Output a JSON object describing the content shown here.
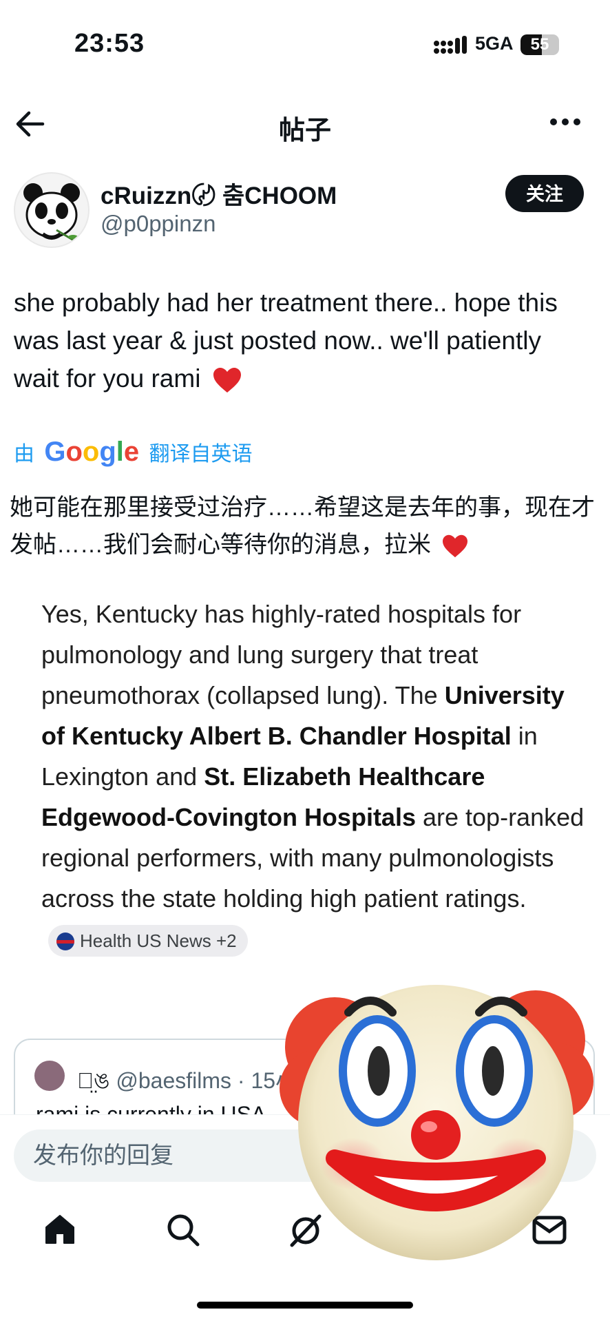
{
  "status_bar": {
    "time": "23:53",
    "network": "5GA",
    "battery": "55",
    "battery_level": 0.55
  },
  "header": {
    "title": "帖子"
  },
  "author": {
    "name": "cRuizzn〄 춤CHOOM",
    "handle": "@p0ppinzn",
    "follow_label": "关注"
  },
  "post": {
    "text": "she probably had her treatment there.. hope this was last year & just posted now.. we'll patiently wait for you rami",
    "emoji": "red-heart"
  },
  "translation": {
    "prefix": "由",
    "brand": "Google",
    "suffix": "翻译自英语",
    "text": "她可能在那里接受过治疗……希望这是去年的事，现在才发帖……我们会耐心等待你的消息，拉米"
  },
  "answer": {
    "p1": "Yes, Kentucky has highly-rated hospitals for pulmonology and lung surgery that treat pneumothorax (collapsed lung). The",
    "b1": "University of Kentucky Albert B. Chandler Hospital",
    "p2": "in Lexington and",
    "b2": "St. Elizabeth Healthcare Edgewood-Covington Hospitals",
    "p3": "are top-ranked regional performers, with many pulmonologists across the state holding high patient ratings.",
    "source": "Health US News +2"
  },
  "quote": {
    "display_name": "ঌ̤ঙ",
    "handle": "@baesfilms",
    "time": "· 15小",
    "text": "rami is currently in USA"
  },
  "reply": {
    "placeholder": "发布你的回复"
  },
  "nav": {
    "icons": [
      "home-icon",
      "search-icon",
      "grok-icon",
      "messages-icon"
    ]
  },
  "overlay": {
    "emoji": "clown-face"
  },
  "colors": {
    "accent": "#1d9bf0",
    "text": "#0f1419",
    "muted": "#536471",
    "follow_bg": "#0f1419",
    "heart": "#e0262b"
  }
}
